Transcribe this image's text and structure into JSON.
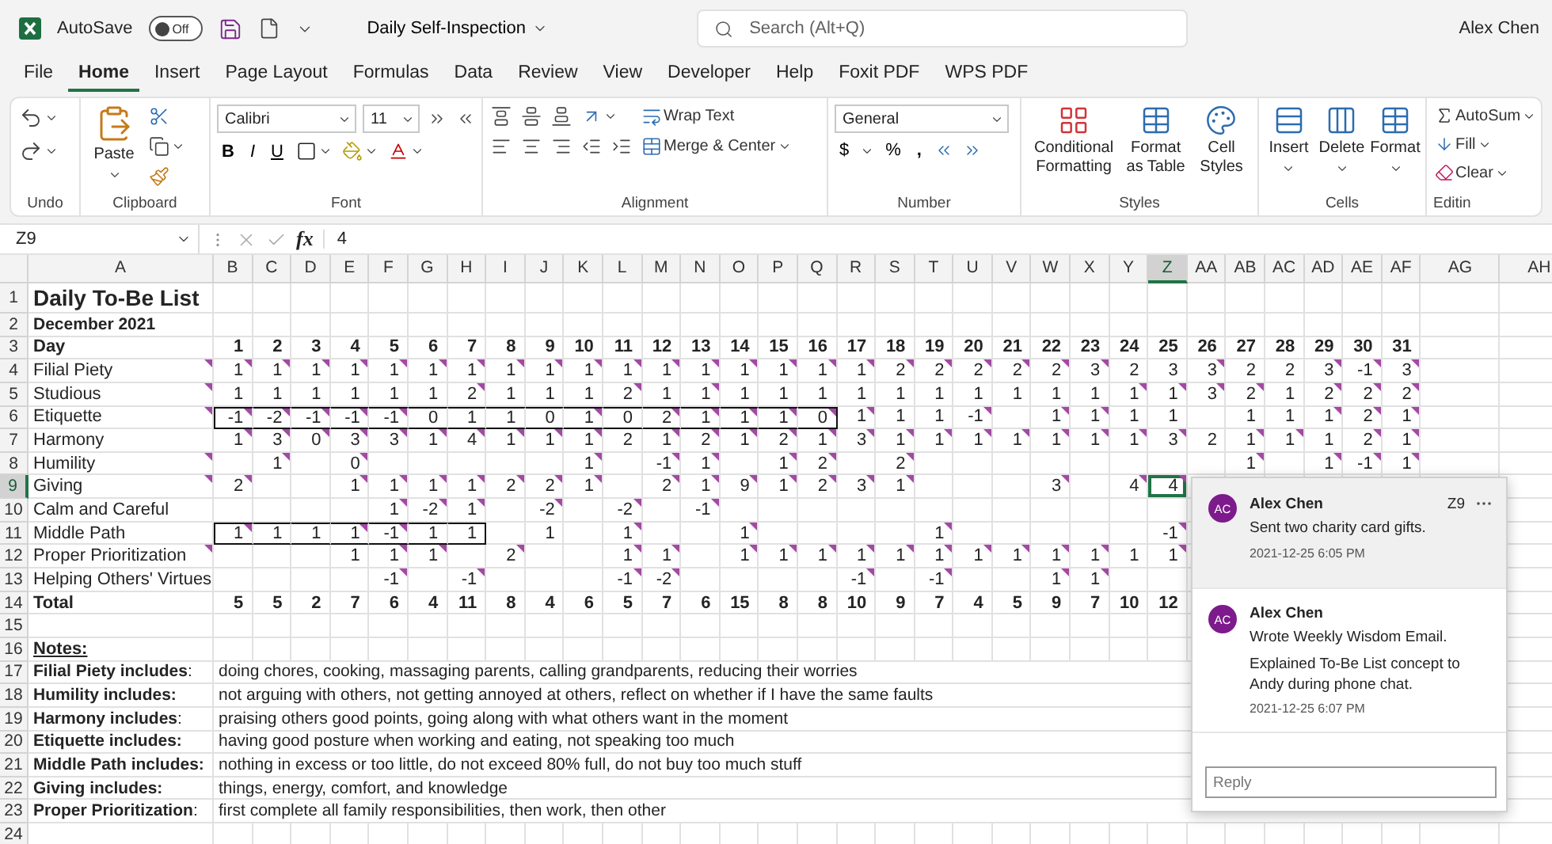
{
  "title_bar": {
    "autosave_label": "AutoSave",
    "autosave": {
      "state": "Off",
      "on": false
    },
    "document": "Daily Self-Inspection",
    "search_placeholder": "Search (Alt+Q)",
    "user": "Alex Chen"
  },
  "tabs": [
    {
      "label": "File",
      "selected": false
    },
    {
      "label": "Home",
      "selected": true
    },
    {
      "label": "Insert",
      "selected": false
    },
    {
      "label": "Page Layout",
      "selected": false
    },
    {
      "label": "Formulas",
      "selected": false
    },
    {
      "label": "Data",
      "selected": false
    },
    {
      "label": "Review",
      "selected": false
    },
    {
      "label": "View",
      "selected": false
    },
    {
      "label": "Developer",
      "selected": false
    },
    {
      "label": "Help",
      "selected": false
    },
    {
      "label": "Foxit PDF",
      "selected": false
    },
    {
      "label": "WPS PDF",
      "selected": false
    }
  ],
  "ribbon": {
    "undo": {
      "label": "Undo"
    },
    "clipboard": {
      "label": "Clipboard",
      "paste": "Paste"
    },
    "font": {
      "label": "Font",
      "family": "Calibri",
      "size": "11",
      "bold": "B",
      "italic": "I",
      "underline": "U"
    },
    "alignment": {
      "label": "Alignment",
      "wrap": "Wrap Text",
      "merge": "Merge & Center"
    },
    "number": {
      "label": "Number",
      "format": "General",
      "currency": "$",
      "percent": "%",
      "comma": ","
    },
    "styles": {
      "label": "Styles",
      "buttons": [
        "Conditional Formatting",
        "Format as Table",
        "Cell Styles"
      ]
    },
    "cells": {
      "label": "Cells",
      "buttons": [
        "Insert",
        "Delete",
        "Format"
      ]
    },
    "editing": {
      "label": "Editin",
      "buttons": [
        "AutoSum",
        "Fill",
        "Clear"
      ]
    }
  },
  "formula_bar": {
    "name_box": "Z9",
    "function_label": "fx",
    "value": "4"
  },
  "sheet": {
    "columns": [
      {
        "label": "A",
        "selected": false
      },
      {
        "label": "B",
        "selected": false
      },
      {
        "label": "C",
        "selected": false
      },
      {
        "label": "D",
        "selected": false
      },
      {
        "label": "E",
        "selected": false
      },
      {
        "label": "F",
        "selected": false
      },
      {
        "label": "G",
        "selected": false
      },
      {
        "label": "H",
        "selected": false
      },
      {
        "label": "I",
        "selected": false
      },
      {
        "label": "J",
        "selected": false
      },
      {
        "label": "K",
        "selected": false
      },
      {
        "label": "L",
        "selected": false
      },
      {
        "label": "M",
        "selected": false
      },
      {
        "label": "N",
        "selected": false
      },
      {
        "label": "O",
        "selected": false
      },
      {
        "label": "P",
        "selected": false
      },
      {
        "label": "Q",
        "selected": false
      },
      {
        "label": "R",
        "selected": false
      },
      {
        "label": "S",
        "selected": false
      },
      {
        "label": "T",
        "selected": false
      },
      {
        "label": "U",
        "selected": false
      },
      {
        "label": "V",
        "selected": false
      },
      {
        "label": "W",
        "selected": false
      },
      {
        "label": "X",
        "selected": false
      },
      {
        "label": "Y",
        "selected": false
      },
      {
        "label": "Z",
        "selected": true
      },
      {
        "label": "AA",
        "selected": false
      },
      {
        "label": "AB",
        "selected": false
      },
      {
        "label": "AC",
        "selected": false
      },
      {
        "label": "AD",
        "selected": false
      },
      {
        "label": "AE",
        "selected": false
      },
      {
        "label": "AF",
        "selected": false
      },
      {
        "label": "AG",
        "selected": false
      },
      {
        "label": "AH",
        "selected": false
      }
    ],
    "row_numbers": [
      {
        "label": "1",
        "selected": false
      },
      {
        "label": "2",
        "selected": false
      },
      {
        "label": "3",
        "selected": false
      },
      {
        "label": "4",
        "selected": false
      },
      {
        "label": "5",
        "selected": false
      },
      {
        "label": "6",
        "selected": false
      },
      {
        "label": "7",
        "selected": false
      },
      {
        "label": "8",
        "selected": false
      },
      {
        "label": "9",
        "selected": true
      },
      {
        "label": "10",
        "selected": false
      },
      {
        "label": "11",
        "selected": false
      },
      {
        "label": "12",
        "selected": false
      },
      {
        "label": "13",
        "selected": false
      },
      {
        "label": "14",
        "selected": false
      },
      {
        "label": "15",
        "selected": false
      },
      {
        "label": "16",
        "selected": false
      },
      {
        "label": "17",
        "selected": false
      },
      {
        "label": "18",
        "selected": false
      },
      {
        "label": "19",
        "selected": false
      },
      {
        "label": "20",
        "selected": false
      },
      {
        "label": "21",
        "selected": false
      },
      {
        "label": "22",
        "selected": false
      },
      {
        "label": "23",
        "selected": false
      },
      {
        "label": "24",
        "selected": false
      }
    ],
    "title": "Daily To-Be List",
    "subtitle": "December 2021",
    "days": [
      "Day",
      "1",
      "2",
      "3",
      "4",
      "5",
      "6",
      "7",
      "8",
      "9",
      "10",
      "11",
      "12",
      "13",
      "14",
      "15",
      "16",
      "17",
      "18",
      "19",
      "20",
      "21",
      "22",
      "23",
      "24",
      "25",
      "26",
      "27",
      "28",
      "29",
      "30",
      "31"
    ],
    "rows": [
      {
        "cells": [
          {
            "value": "Filial Piety",
            "commented": true
          },
          {
            "value": "1",
            "commented": true
          },
          {
            "value": "1",
            "commented": true
          },
          {
            "value": "1",
            "commented": true
          },
          {
            "value": "1",
            "commented": true
          },
          {
            "value": "1",
            "commented": true
          },
          {
            "value": "1",
            "commented": true
          },
          {
            "value": "1",
            "commented": true
          },
          {
            "value": "1",
            "commented": true
          },
          {
            "value": "1",
            "commented": true
          },
          {
            "value": "1",
            "commented": true
          },
          {
            "value": "1",
            "commented": true
          },
          {
            "value": "1",
            "commented": true
          },
          {
            "value": "1",
            "commented": true
          },
          {
            "value": "1",
            "commented": true
          },
          {
            "value": "1",
            "commented": true
          },
          {
            "value": "1",
            "commented": true
          },
          {
            "value": "1",
            "commented": true
          },
          {
            "value": "2",
            "commented": true
          },
          {
            "value": "2",
            "commented": true
          },
          {
            "value": "2",
            "commented": true
          },
          {
            "value": "2",
            "commented": true
          },
          {
            "value": "2",
            "commented": true
          },
          {
            "value": "3",
            "commented": true
          },
          {
            "value": "2",
            "commented": false
          },
          {
            "value": "3",
            "commented": false
          },
          {
            "value": "3",
            "commented": true
          },
          {
            "value": "2",
            "commented": false
          },
          {
            "value": "2",
            "commented": false
          },
          {
            "value": "3",
            "commented": true
          },
          {
            "value": "-1",
            "commented": true
          },
          {
            "value": "3",
            "commented": true
          }
        ]
      },
      {
        "cells": [
          {
            "value": "Studious",
            "commented": true
          },
          {
            "value": "1",
            "commented": false
          },
          {
            "value": "1",
            "commented": false
          },
          {
            "value": "1",
            "commented": false
          },
          {
            "value": "1",
            "commented": false
          },
          {
            "value": "1",
            "commented": false
          },
          {
            "value": "1",
            "commented": false
          },
          {
            "value": "2",
            "commented": true
          },
          {
            "value": "1",
            "commented": false
          },
          {
            "value": "1",
            "commented": false
          },
          {
            "value": "1",
            "commented": false
          },
          {
            "value": "2",
            "commented": true
          },
          {
            "value": "1",
            "commented": false
          },
          {
            "value": "1",
            "commented": true
          },
          {
            "value": "1",
            "commented": false
          },
          {
            "value": "1",
            "commented": false
          },
          {
            "value": "1",
            "commented": false
          },
          {
            "value": "1",
            "commented": false
          },
          {
            "value": "1",
            "commented": false
          },
          {
            "value": "1",
            "commented": false
          },
          {
            "value": "1",
            "commented": false
          },
          {
            "value": "1",
            "commented": false
          },
          {
            "value": "1",
            "commented": false
          },
          {
            "value": "1",
            "commented": false
          },
          {
            "value": "1",
            "commented": true
          },
          {
            "value": "1",
            "commented": true
          },
          {
            "value": "3",
            "commented": true
          },
          {
            "value": "2",
            "commented": true
          },
          {
            "value": "1",
            "commented": false
          },
          {
            "value": "2",
            "commented": true
          },
          {
            "value": "2",
            "commented": true
          },
          {
            "value": "2",
            "commented": true
          }
        ]
      },
      {
        "cells": [
          {
            "value": "Etiquette",
            "commented": true,
            "outlined": false
          },
          {
            "value": "-1",
            "commented": true,
            "outlined": true
          },
          {
            "value": "-2",
            "commented": true,
            "outlined": true
          },
          {
            "value": "-1",
            "commented": true,
            "outlined": true
          },
          {
            "value": "-1",
            "commented": true,
            "outlined": true
          },
          {
            "value": "-1",
            "commented": true,
            "outlined": true
          },
          {
            "value": "0",
            "commented": false,
            "outlined": true
          },
          {
            "value": "1",
            "commented": false,
            "outlined": true
          },
          {
            "value": "1",
            "commented": false,
            "outlined": true
          },
          {
            "value": "0",
            "commented": false,
            "outlined": true
          },
          {
            "value": "1",
            "commented": true,
            "outlined": true
          },
          {
            "value": "0",
            "commented": false,
            "outlined": true
          },
          {
            "value": "2",
            "commented": true,
            "outlined": true
          },
          {
            "value": "1",
            "commented": true,
            "outlined": true
          },
          {
            "value": "1",
            "commented": true,
            "outlined": true
          },
          {
            "value": "1",
            "commented": true,
            "outlined": true
          },
          {
            "value": "0",
            "commented": true,
            "outlined": true
          },
          {
            "value": "1",
            "commented": true,
            "outlined": false
          },
          {
            "value": "1",
            "commented": false,
            "outlined": false
          },
          {
            "value": "1",
            "commented": false,
            "outlined": false
          },
          {
            "value": "-1",
            "commented": true,
            "outlined": false
          },
          {
            "commented": false,
            "outlined": false
          },
          {
            "value": "1",
            "commented": true,
            "outlined": false
          },
          {
            "value": "1",
            "commented": true,
            "outlined": false
          },
          {
            "value": "1",
            "commented": false,
            "outlined": false
          },
          {
            "value": "1",
            "commented": false,
            "outlined": false
          },
          {
            "commented": false,
            "outlined": false
          },
          {
            "value": "1",
            "commented": false,
            "outlined": false
          },
          {
            "value": "1",
            "commented": false,
            "outlined": false
          },
          {
            "value": "1",
            "commented": true,
            "outlined": false
          },
          {
            "value": "2",
            "commented": true,
            "outlined": false
          },
          {
            "value": "1",
            "commented": true,
            "outlined": false
          }
        ]
      },
      {
        "cells": [
          {
            "value": "Harmony",
            "commented": false
          },
          {
            "value": "1",
            "commented": true
          },
          {
            "value": "3",
            "commented": true
          },
          {
            "value": "0",
            "commented": true
          },
          {
            "value": "3",
            "commented": true
          },
          {
            "value": "3",
            "commented": true
          },
          {
            "value": "1",
            "commented": true
          },
          {
            "value": "4",
            "commented": true
          },
          {
            "value": "1",
            "commented": true
          },
          {
            "value": "1",
            "commented": true
          },
          {
            "value": "1",
            "commented": true
          },
          {
            "value": "2",
            "commented": false
          },
          {
            "value": "1",
            "commented": true
          },
          {
            "value": "2",
            "commented": true
          },
          {
            "value": "1",
            "commented": true
          },
          {
            "value": "2",
            "commented": true
          },
          {
            "value": "1",
            "commented": true
          },
          {
            "value": "3",
            "commented": true
          },
          {
            "value": "1",
            "commented": true
          },
          {
            "value": "1",
            "commented": true
          },
          {
            "value": "1",
            "commented": true
          },
          {
            "value": "1",
            "commented": true
          },
          {
            "value": "1",
            "commented": true
          },
          {
            "value": "1",
            "commented": true
          },
          {
            "value": "1",
            "commented": true
          },
          {
            "value": "3",
            "commented": true
          },
          {
            "value": "2",
            "commented": false
          },
          {
            "value": "1",
            "commented": true
          },
          {
            "value": "1",
            "commented": true
          },
          {
            "value": "1",
            "commented": false
          },
          {
            "value": "2",
            "commented": true
          },
          {
            "value": "1",
            "commented": true
          }
        ]
      },
      {
        "cells": [
          {
            "value": "Humility",
            "commented": true
          },
          {
            "commented": false
          },
          {
            "value": "1",
            "commented": true
          },
          {
            "commented": false
          },
          {
            "value": "0",
            "commented": true
          },
          {
            "commented": false
          },
          {
            "commented": false
          },
          {
            "commented": false
          },
          {
            "commented": false
          },
          {
            "commented": false
          },
          {
            "value": "1",
            "commented": true
          },
          {
            "commented": false
          },
          {
            "value": "-1",
            "commented": true
          },
          {
            "value": "1",
            "commented": true
          },
          {
            "commented": false
          },
          {
            "value": "1",
            "commented": true
          },
          {
            "value": "2",
            "commented": true
          },
          {
            "commented": false
          },
          {
            "value": "2",
            "commented": true
          },
          {
            "commented": false
          },
          {
            "commented": false
          },
          {
            "commented": false
          },
          {
            "commented": false
          },
          {
            "commented": false
          },
          {
            "commented": false
          },
          {
            "commented": false
          },
          {
            "commented": false
          },
          {
            "value": "1",
            "commented": true
          },
          {
            "commented": false
          },
          {
            "value": "1",
            "commented": true
          },
          {
            "value": "-1",
            "commented": true
          },
          {
            "value": "1",
            "commented": true
          }
        ]
      },
      {
        "cells": [
          {
            "value": "Giving",
            "commented": true
          },
          {
            "value": "2",
            "commented": true
          },
          {
            "commented": false
          },
          {
            "commented": false
          },
          {
            "value": "1",
            "commented": true
          },
          {
            "value": "1",
            "commented": true
          },
          {
            "value": "1",
            "commented": true
          },
          {
            "value": "1",
            "commented": true
          },
          {
            "value": "2",
            "commented": true
          },
          {
            "value": "2",
            "commented": true
          },
          {
            "value": "1",
            "commented": true
          },
          {
            "commented": false
          },
          {
            "value": "2",
            "commented": true
          },
          {
            "value": "1",
            "commented": true
          },
          {
            "value": "9",
            "commented": true
          },
          {
            "value": "1",
            "commented": true
          },
          {
            "value": "2",
            "commented": true
          },
          {
            "value": "3",
            "commented": true
          },
          {
            "value": "1",
            "commented": true
          },
          {
            "commented": false
          },
          {
            "commented": false
          },
          {
            "commented": false
          },
          {
            "value": "3",
            "commented": true
          },
          {
            "commented": false
          },
          {
            "value": "4",
            "commented": true
          },
          {
            "value": "4",
            "commented": true
          }
        ]
      },
      {
        "cells": [
          {
            "value": "Calm and Careful",
            "commented": false
          },
          {
            "commented": false
          },
          {
            "commented": false
          },
          {
            "commented": false
          },
          {
            "commented": false
          },
          {
            "value": "1",
            "commented": true
          },
          {
            "value": "-2",
            "commented": true
          },
          {
            "value": "1",
            "commented": true
          },
          {
            "commented": false
          },
          {
            "value": "-2",
            "commented": true
          },
          {
            "commented": false
          },
          {
            "value": "-2",
            "commented": true
          },
          {
            "commented": false
          },
          {
            "value": "-1",
            "commented": true
          }
        ]
      },
      {
        "cells": [
          {
            "value": "Middle Path",
            "commented": false,
            "outlined": false
          },
          {
            "value": "1",
            "commented": true,
            "outlined": true
          },
          {
            "value": "1",
            "commented": false,
            "outlined": true
          },
          {
            "value": "1",
            "commented": false,
            "outlined": true
          },
          {
            "value": "1",
            "commented": true,
            "outlined": true
          },
          {
            "value": "-1",
            "commented": true,
            "outlined": true
          },
          {
            "value": "1",
            "commented": false,
            "outlined": true
          },
          {
            "value": "1",
            "commented": false,
            "outlined": true
          },
          {
            "commented": false,
            "outlined": false
          },
          {
            "value": "1",
            "commented": false,
            "outlined": false
          },
          {
            "commented": false,
            "outlined": false
          },
          {
            "value": "1",
            "commented": true,
            "outlined": false
          },
          {
            "commented": false,
            "outlined": false
          },
          {
            "commented": false,
            "outlined": false
          },
          {
            "value": "1",
            "commented": true,
            "outlined": false
          },
          {
            "commented": false,
            "outlined": false
          },
          {
            "commented": false,
            "outlined": false
          },
          {
            "commented": false,
            "outlined": false
          },
          {
            "commented": false,
            "outlined": false
          },
          {
            "value": "1",
            "commented": true,
            "outlined": false
          },
          {
            "commented": false,
            "outlined": false
          },
          {
            "commented": false,
            "outlined": false
          },
          {
            "commented": false,
            "outlined": false
          },
          {
            "commented": false,
            "outlined": false
          },
          {
            "commented": false,
            "outlined": false
          },
          {
            "value": "-1",
            "commented": true,
            "outlined": false
          }
        ]
      },
      {
        "cells": [
          {
            "value": "Proper Prioritization",
            "commented": true
          },
          {
            "commented": false
          },
          {
            "commented": false
          },
          {
            "commented": false
          },
          {
            "value": "1",
            "commented": false
          },
          {
            "value": "1",
            "commented": true
          },
          {
            "value": "1",
            "commented": true
          },
          {
            "commented": false
          },
          {
            "value": "2",
            "commented": true
          },
          {
            "commented": false
          },
          {
            "commented": false
          },
          {
            "value": "1",
            "commented": true
          },
          {
            "value": "1",
            "commented": true
          },
          {
            "commented": false
          },
          {
            "value": "1",
            "commented": true
          },
          {
            "value": "1",
            "commented": true
          },
          {
            "value": "1",
            "commented": true
          },
          {
            "value": "1",
            "commented": true
          },
          {
            "value": "1",
            "commented": true
          },
          {
            "value": "1",
            "commented": true
          },
          {
            "value": "1",
            "commented": true
          },
          {
            "value": "1",
            "commented": true
          },
          {
            "value": "1",
            "commented": true
          },
          {
            "value": "1",
            "commented": true
          },
          {
            "value": "1",
            "commented": false
          },
          {
            "value": "1",
            "commented": true
          }
        ]
      },
      {
        "cells": [
          {
            "value": "Helping Others' Virtues",
            "commented": false
          },
          {
            "commented": false
          },
          {
            "commented": false
          },
          {
            "commented": false
          },
          {
            "commented": false
          },
          {
            "value": "-1",
            "commented": true
          },
          {
            "commented": false
          },
          {
            "value": "-1",
            "commented": true
          },
          {
            "commented": false
          },
          {
            "commented": false
          },
          {
            "commented": false
          },
          {
            "value": "-1",
            "commented": true
          },
          {
            "value": "-2",
            "commented": true
          },
          {
            "commented": false
          },
          {
            "commented": false
          },
          {
            "commented": false
          },
          {
            "commented": false
          },
          {
            "value": "-1",
            "commented": true
          },
          {
            "commented": false
          },
          {
            "value": "-1",
            "commented": true
          },
          {
            "commented": false
          },
          {
            "commented": false
          },
          {
            "value": "1",
            "commented": true
          },
          {
            "value": "1",
            "commented": true
          }
        ]
      }
    ],
    "total": {
      "values": [
        "Total",
        "5",
        "5",
        "2",
        "7",
        "6",
        "4",
        "11",
        "8",
        "4",
        "6",
        "5",
        "7",
        "6",
        "15",
        "8",
        "8",
        "10",
        "9",
        "7",
        "4",
        "5",
        "9",
        "7",
        "10",
        "12"
      ]
    },
    "notes": {
      "heading": "Notes:",
      "items": [
        {
          "label": "**Filial Piety includes**:",
          "text": "doing chores, cooking, massaging parents, calling grandparents, reducing their worries"
        },
        {
          "label": "**Humility includes:**",
          "text": "not arguing with others, not getting annoyed at others, reflect on whether if I have the same faults"
        },
        {
          "label": "**Harmony includes**:",
          "text": "praising others good points, going along with what others want in the moment"
        },
        {
          "label": "**Etiquette includes:**",
          "text": "having good posture when working and eating, not speaking too much"
        },
        {
          "label": "**Middle Path includes:**",
          "text": "nothing in excess or too little, do not exceed 80% full, do not buy too much stuff"
        },
        {
          "label": "**Giving includes:**",
          "text": "things, energy, comfort, and knowledge"
        },
        {
          "label": "**Proper Prioritization**:",
          "text": "first complete all family responsibilities, then work, then other"
        }
      ]
    }
  },
  "comments": {
    "threads": [
      {
        "initials": "AC",
        "author": "Alex Chen",
        "cell": "Z9",
        "paragraphs": [
          "Sent two charity card gifts."
        ],
        "time": "2021-12-25 6:05 PM",
        "selected": true
      },
      {
        "initials": "AC",
        "author": "Alex Chen",
        "paragraphs": [
          "Wrote Weekly Wisdom Email.",
          "Explained To-Be List concept to Andy during phone chat."
        ],
        "time": "2021-12-25 6:07 PM",
        "selected": false
      }
    ],
    "reply_placeholder": "Reply"
  }
}
